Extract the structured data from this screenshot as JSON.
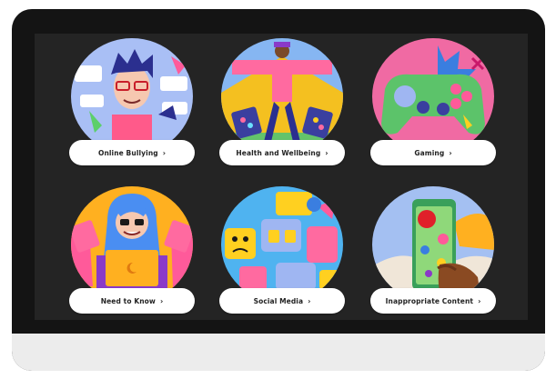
{
  "topics": [
    {
      "label": "Online Bullying",
      "icon": "bullying-illustration",
      "bg": "#9fb6f2"
    },
    {
      "label": "Health and Wellbeing",
      "icon": "wellbeing-illustration",
      "bg": "#7fb0f0"
    },
    {
      "label": "Gaming",
      "icon": "gaming-illustration",
      "bg": "#f06aa3"
    },
    {
      "label": "Need to Know",
      "icon": "need-to-know-illustration",
      "bg": "#ffb020"
    },
    {
      "label": "Social Media",
      "icon": "social-media-illustration",
      "bg": "#4fb3f0"
    },
    {
      "label": "Inappropriate Content",
      "icon": "inappropriate-content-illustration",
      "bg": "#9fbef2"
    }
  ],
  "chevron": "›",
  "colors": {
    "frame": "#141414",
    "screen": "#242424",
    "chin": "#ececec",
    "pill": "#ffffff"
  }
}
